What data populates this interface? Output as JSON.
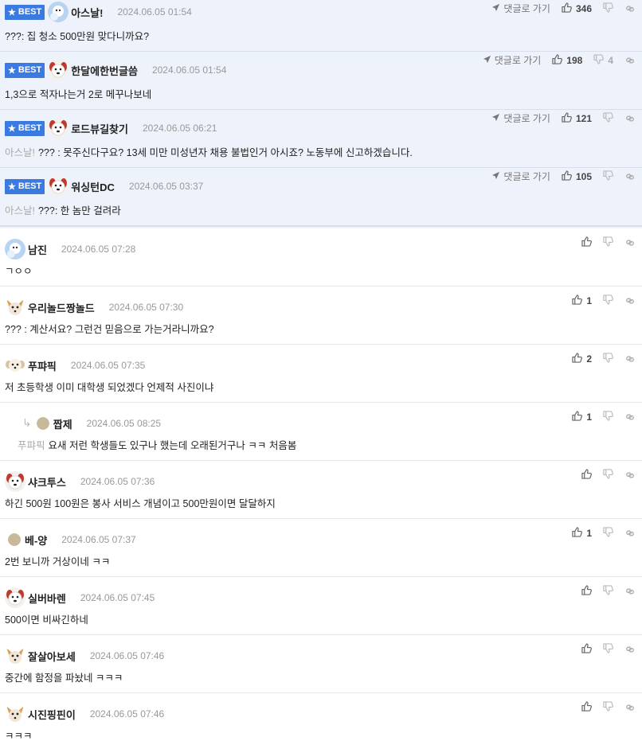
{
  "best_badge": "BEST",
  "go_to_reply": "댓글로 가기",
  "best_comments": [
    {
      "nick": "아스날!",
      "date": "2024.06.05 01:54",
      "mention": "",
      "text": "???: 집 청소 500만원 맞다니까요?",
      "likes": "346",
      "dislikes": "",
      "avatar": "snow-avatar"
    },
    {
      "nick": "한달에한번글씀",
      "date": "2024.06.05 01:54",
      "mention": "",
      "text": "1,3으로 적자나는거 2로 메꾸나보네",
      "likes": "198",
      "dislikes": "4",
      "avatar": "dog-avatar"
    },
    {
      "nick": "로드뷰길찾기",
      "date": "2024.06.05 06:21",
      "mention": "아스날!",
      "text": "??? : 못주신다구요? 13세 미만 미성년자 채용 불법인거 아시죠? 노동부에 신고하겠습니다.",
      "likes": "121",
      "dislikes": "",
      "avatar": "dog-avatar"
    },
    {
      "nick": "워싱턴DC",
      "date": "2024.06.05 03:37",
      "mention": "아스날!",
      "text": "???: 한 놈만 걸려라",
      "likes": "105",
      "dislikes": "",
      "avatar": "dog-avatar"
    }
  ],
  "comments": [
    {
      "nick": "남진",
      "date": "2024.06.05 07:28",
      "mention": "",
      "text": "ㄱㅇㅇ",
      "likes": "",
      "avatar": "snow-avatar",
      "reply": false
    },
    {
      "nick": "우리놀드짱놀드",
      "date": "2024.06.05 07:30",
      "mention": "",
      "text": "??? : 계산서요? 그런건 믿음으로 가는거라니까요?",
      "likes": "1",
      "avatar": "chihuahua-avatar",
      "reply": false
    },
    {
      "nick": "푸퍄픽",
      "date": "2024.06.05 07:35",
      "mention": "",
      "text": "저 초등학생 이미 대학생 되었겠다 언제적 사진이냐",
      "likes": "2",
      "avatar": "puppy-avatar",
      "reply": false
    },
    {
      "nick": "짭제",
      "date": "2024.06.05 08:25",
      "mention": "푸퍄픽",
      "text": "요새 저런 학생들도 있구나 했는데 오래된거구나 ㅋㅋ 처음봄",
      "likes": "1",
      "avatar": "dot-avatar",
      "reply": true
    },
    {
      "nick": "샤크투스",
      "date": "2024.06.05 07:36",
      "mention": "",
      "text": "하긴 500원 100원은 봉사 서비스 개념이고 500만원이면 달달하지",
      "likes": "",
      "avatar": "dog-avatar",
      "reply": false
    },
    {
      "nick": "베-양",
      "date": "2024.06.05 07:37",
      "mention": "",
      "text": "2번 보니까 거상이네 ㅋㅋ",
      "likes": "1",
      "avatar": "dot-avatar",
      "reply": false
    },
    {
      "nick": "실버바렌",
      "date": "2024.06.05 07:45",
      "mention": "",
      "text": "500이면 비싸긴하네",
      "likes": "",
      "avatar": "dog-avatar",
      "reply": false
    },
    {
      "nick": "잘살아보세",
      "date": "2024.06.05 07:46",
      "mention": "",
      "text": "중간에 함정을 파놨네 ㅋㅋㅋ",
      "likes": "",
      "avatar": "chihuahua-avatar",
      "reply": false
    },
    {
      "nick": "시진핑핀이",
      "date": "2024.06.05 07:46",
      "mention": "",
      "text": "ㅋㅋㅋ",
      "likes": "",
      "avatar": "chihuahua-avatar",
      "reply": false
    }
  ],
  "colors": {
    "accent": "#3b7be0",
    "best_bg": "#eef2fb"
  }
}
